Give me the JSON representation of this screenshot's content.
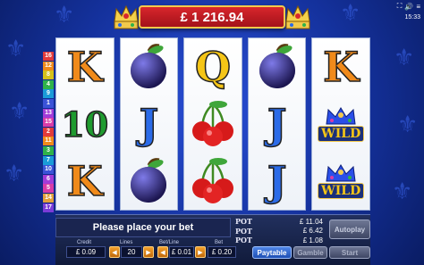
{
  "header": {
    "credit_banner": "£ 1 216.94",
    "status_time": "15:33"
  },
  "reels": [
    [
      "king",
      "ten",
      "king"
    ],
    [
      "plum",
      "jack",
      "plum"
    ],
    [
      "queen",
      "cherries",
      "cherries"
    ],
    [
      "plum",
      "jack",
      "jack"
    ],
    [
      "king",
      "wild",
      "wild"
    ]
  ],
  "symbols": {
    "king": "K",
    "queen": "Q",
    "jack": "J",
    "ten": "10",
    "wild": "WILD"
  },
  "paylines": {
    "left": [
      "16",
      "12",
      "8",
      "4",
      "9",
      "1",
      "13",
      "15",
      "2",
      "11",
      "3",
      "7",
      "10",
      "6",
      "5",
      "14",
      "17"
    ],
    "right": [
      "",
      "",
      "",
      "",
      "",
      "",
      "",
      "",
      "",
      "",
      "",
      "",
      "",
      "",
      "",
      "",
      ""
    ],
    "colors": [
      "#e23b3b",
      "#f08a1a",
      "#d6c21a",
      "#2fb24a",
      "#1b9bd8",
      "#3b53d8",
      "#a23bd8",
      "#d83ba8",
      "#e23b3b",
      "#f08a1a",
      "#2fb24a",
      "#1b9bd8",
      "#3b53d8",
      "#a23bd8",
      "#d83ba8",
      "#e2a03b",
      "#7b3bd8"
    ]
  },
  "message": "Please place your bet",
  "pots": [
    {
      "label": "POT",
      "value": "£ 11.04"
    },
    {
      "label": "POT",
      "value": "£ 6.42"
    },
    {
      "label": "POT",
      "value": "£ 1.08"
    }
  ],
  "controls": {
    "credit_label": "Credit",
    "credit_value": "£ 0.09",
    "lines_label": "Lines",
    "lines_value": "20",
    "betline_label": "Bet/Line",
    "betline_value": "£ 0.01",
    "bet_label": "Bet",
    "bet_value": "£ 0.20",
    "autoplay": "Autoplay",
    "paytable": "Paytable",
    "gamble": "Gamble",
    "start": "Start"
  }
}
